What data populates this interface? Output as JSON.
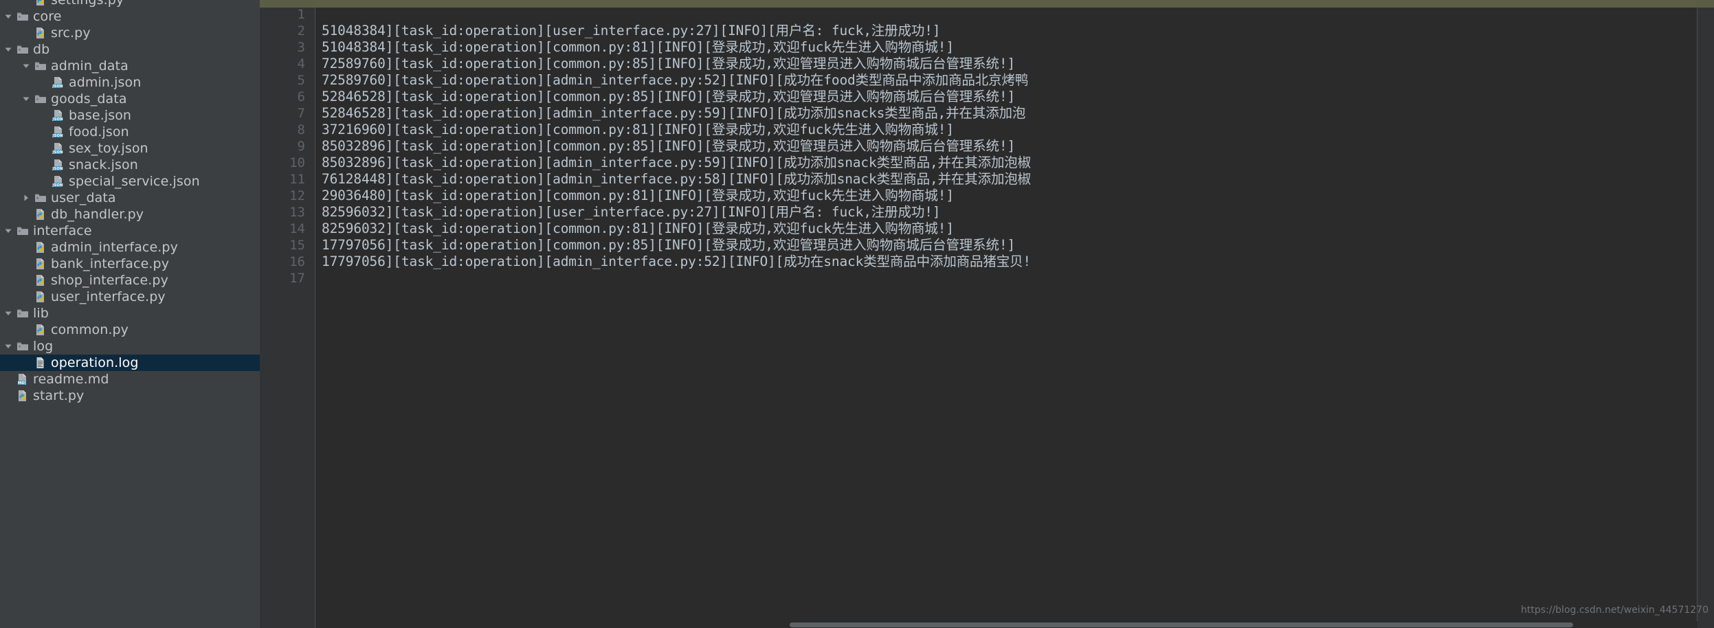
{
  "sidebar": {
    "tree": [
      {
        "label": "settings.py",
        "icon": "python-file-icon",
        "twisty": "none",
        "indent": 1,
        "selected": false,
        "clipped_top": true
      },
      {
        "label": "core",
        "icon": "folder-icon",
        "twisty": "expanded",
        "indent": 0,
        "selected": false
      },
      {
        "label": "src.py",
        "icon": "python-file-icon",
        "twisty": "none",
        "indent": 1,
        "selected": false
      },
      {
        "label": "db",
        "icon": "folder-icon",
        "twisty": "expanded",
        "indent": 0,
        "selected": false
      },
      {
        "label": "admin_data",
        "icon": "folder-icon",
        "twisty": "expanded",
        "indent": 1,
        "selected": false
      },
      {
        "label": "admin.json",
        "icon": "json-file-icon",
        "twisty": "none",
        "indent": 2,
        "selected": false
      },
      {
        "label": "goods_data",
        "icon": "folder-icon",
        "twisty": "expanded",
        "indent": 1,
        "selected": false
      },
      {
        "label": "base.json",
        "icon": "json-file-icon",
        "twisty": "none",
        "indent": 2,
        "selected": false
      },
      {
        "label": "food.json",
        "icon": "json-file-icon",
        "twisty": "none",
        "indent": 2,
        "selected": false
      },
      {
        "label": "sex_toy.json",
        "icon": "json-file-icon",
        "twisty": "none",
        "indent": 2,
        "selected": false
      },
      {
        "label": "snack.json",
        "icon": "json-file-icon",
        "twisty": "none",
        "indent": 2,
        "selected": false
      },
      {
        "label": "special_service.json",
        "icon": "json-file-icon",
        "twisty": "none",
        "indent": 2,
        "selected": false
      },
      {
        "label": "user_data",
        "icon": "folder-icon",
        "twisty": "collapsed",
        "indent": 1,
        "selected": false
      },
      {
        "label": "db_handler.py",
        "icon": "python-file-icon",
        "twisty": "none",
        "indent": 1,
        "selected": false
      },
      {
        "label": "interface",
        "icon": "folder-icon",
        "twisty": "expanded",
        "indent": 0,
        "selected": false
      },
      {
        "label": "admin_interface.py",
        "icon": "python-file-icon",
        "twisty": "none",
        "indent": 1,
        "selected": false
      },
      {
        "label": "bank_interface.py",
        "icon": "python-file-icon",
        "twisty": "none",
        "indent": 1,
        "selected": false
      },
      {
        "label": "shop_interface.py",
        "icon": "python-file-icon",
        "twisty": "none",
        "indent": 1,
        "selected": false
      },
      {
        "label": "user_interface.py",
        "icon": "python-file-icon",
        "twisty": "none",
        "indent": 1,
        "selected": false
      },
      {
        "label": "lib",
        "icon": "folder-icon",
        "twisty": "expanded",
        "indent": 0,
        "selected": false
      },
      {
        "label": "common.py",
        "icon": "python-file-icon",
        "twisty": "none",
        "indent": 1,
        "selected": false
      },
      {
        "label": "log",
        "icon": "folder-icon",
        "twisty": "expanded",
        "indent": 0,
        "selected": false
      },
      {
        "label": "operation.log",
        "icon": "log-file-icon",
        "twisty": "none",
        "indent": 1,
        "selected": true
      },
      {
        "label": "readme.md",
        "icon": "markdown-file-icon",
        "twisty": "none",
        "indent": 0,
        "selected": false
      },
      {
        "label": "start.py",
        "icon": "python-file-icon",
        "twisty": "none",
        "indent": 0,
        "selected": false
      }
    ]
  },
  "editor": {
    "lines": [
      {
        "number": "1",
        "text": ""
      },
      {
        "number": "2",
        "text": "51048384][task_id:operation][user_interface.py:27][INFO][用户名: fuck,注册成功!]"
      },
      {
        "number": "3",
        "text": "51048384][task_id:operation][common.py:81][INFO][登录成功,欢迎fuck先生进入购物商城!]"
      },
      {
        "number": "4",
        "text": "72589760][task_id:operation][common.py:85][INFO][登录成功,欢迎管理员进入购物商城后台管理系统!]"
      },
      {
        "number": "5",
        "text": "72589760][task_id:operation][admin_interface.py:52][INFO][成功在food类型商品中添加商品北京烤鸭"
      },
      {
        "number": "6",
        "text": "52846528][task_id:operation][common.py:85][INFO][登录成功,欢迎管理员进入购物商城后台管理系统!]"
      },
      {
        "number": "7",
        "text": "52846528][task_id:operation][admin_interface.py:59][INFO][成功添加snacks类型商品,并在其添加泡"
      },
      {
        "number": "8",
        "text": "37216960][task_id:operation][common.py:81][INFO][登录成功,欢迎fuck先生进入购物商城!]"
      },
      {
        "number": "9",
        "text": "85032896][task_id:operation][common.py:85][INFO][登录成功,欢迎管理员进入购物商城后台管理系统!]"
      },
      {
        "number": "10",
        "text": "85032896][task_id:operation][admin_interface.py:59][INFO][成功添加snack类型商品,并在其添加泡椒"
      },
      {
        "number": "11",
        "text": "76128448][task_id:operation][admin_interface.py:58][INFO][成功添加snack类型商品,并在其添加泡椒"
      },
      {
        "number": "12",
        "text": "29036480][task_id:operation][common.py:81][INFO][登录成功,欢迎fuck先生进入购物商城!]"
      },
      {
        "number": "13",
        "text": "82596032][task_id:operation][user_interface.py:27][INFO][用户名: fuck,注册成功!]"
      },
      {
        "number": "14",
        "text": "82596032][task_id:operation][common.py:81][INFO][登录成功,欢迎fuck先生进入购物商城!]"
      },
      {
        "number": "15",
        "text": "17797056][task_id:operation][common.py:85][INFO][登录成功,欢迎管理员进入购物商城后台管理系统!]"
      },
      {
        "number": "16",
        "text": "17797056][task_id:operation][admin_interface.py:52][INFO][成功在snack类型商品中添加商品猪宝贝!"
      },
      {
        "number": "17",
        "text": ""
      }
    ]
  },
  "watermark": {
    "text": "https://blog.csdn.net/weixin_44571270"
  },
  "colors": {
    "sidebar_bg": "#3c3f41",
    "editor_bg": "#2b2b2b",
    "gutter_bg": "#313335",
    "selection_bg": "#0d293e",
    "code_fg": "#b9c4cf",
    "gutter_fg": "#606366",
    "tabstrip_bg": "#5b5e45",
    "tree_fg": "#c3c6c9"
  }
}
